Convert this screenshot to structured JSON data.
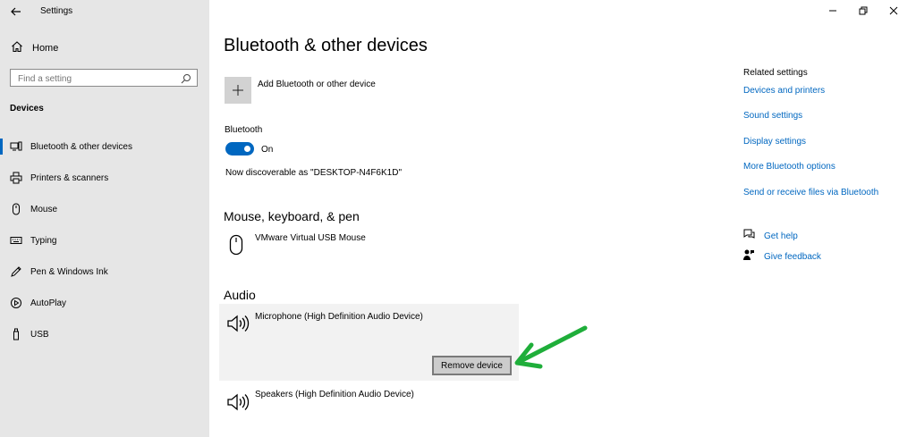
{
  "window": {
    "title": "Settings",
    "controls": {
      "minimize": "—",
      "restore": "❐",
      "close": "✕"
    }
  },
  "sidebar": {
    "home_label": "Home",
    "search_placeholder": "Find a setting",
    "section_label": "Devices",
    "items": [
      {
        "label": "Bluetooth & other devices",
        "icon": "bluetooth-devices-icon",
        "active": true
      },
      {
        "label": "Printers & scanners",
        "icon": "printer-icon"
      },
      {
        "label": "Mouse",
        "icon": "mouse-icon"
      },
      {
        "label": "Typing",
        "icon": "keyboard-icon"
      },
      {
        "label": "Pen & Windows Ink",
        "icon": "pen-icon"
      },
      {
        "label": "AutoPlay",
        "icon": "autoplay-icon"
      },
      {
        "label": "USB",
        "icon": "usb-icon"
      }
    ]
  },
  "main": {
    "title": "Bluetooth & other devices",
    "add_label": "Add Bluetooth or other device",
    "bluetooth_label": "Bluetooth",
    "toggle_state": "On",
    "discoverable_text": "Now discoverable as \"DESKTOP-N4F6K1D\"",
    "mouse_section": "Mouse, keyboard, & pen",
    "mouse_device": "VMware Virtual USB Mouse",
    "audio_section": "Audio",
    "audio_devices": [
      "Microphone (High Definition Audio Device)",
      "Speakers (High Definition Audio Device)"
    ],
    "remove_label": "Remove device"
  },
  "related": {
    "heading": "Related settings",
    "links": [
      "Devices and printers",
      "Sound settings",
      "Display settings",
      "More Bluetooth options",
      "Send or receive files via Bluetooth"
    ],
    "help": [
      {
        "label": "Get help",
        "icon": "help-chat-icon"
      },
      {
        "label": "Give feedback",
        "icon": "feedback-icon"
      }
    ]
  },
  "colors": {
    "accent": "#0067c0",
    "sidebar_bg": "#e6e6e6",
    "arrow": "#1fae3a"
  }
}
